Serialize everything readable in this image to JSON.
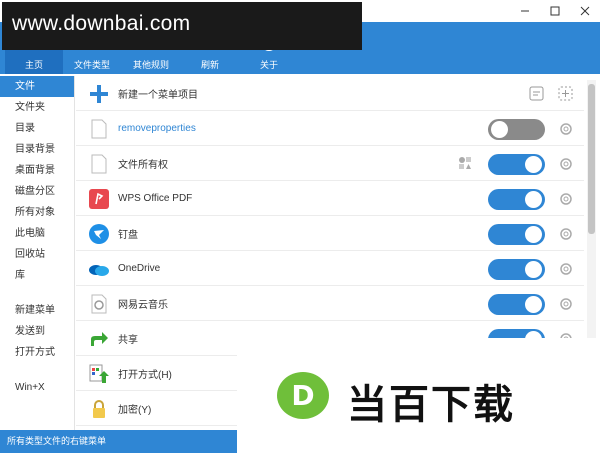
{
  "watermark": {
    "text": "www.downbai.com"
  },
  "toolbar": {
    "items": [
      {
        "label": "主页"
      },
      {
        "label": "文件类型"
      },
      {
        "label": "其他规则"
      },
      {
        "label": "刷新"
      },
      {
        "label": "关于"
      }
    ]
  },
  "sidebar": {
    "items": [
      {
        "label": "文件"
      },
      {
        "label": "文件夹"
      },
      {
        "label": "目录"
      },
      {
        "label": "目录背景"
      },
      {
        "label": "桌面背景"
      },
      {
        "label": "磁盘分区"
      },
      {
        "label": "所有对象"
      },
      {
        "label": "此电脑"
      },
      {
        "label": "回收站"
      },
      {
        "label": "库"
      },
      {
        "label": "新建菜单"
      },
      {
        "label": "发送到"
      },
      {
        "label": "打开方式"
      },
      {
        "label": "Win+X"
      }
    ]
  },
  "list": {
    "new_item_label": "新建一个菜单项目",
    "rows": [
      {
        "label": "removeproperties",
        "enabled": false,
        "icon": "document-icon"
      },
      {
        "label": "文件所有权",
        "enabled": true,
        "icon": "document-icon"
      },
      {
        "label": "WPS Office PDF",
        "enabled": true,
        "icon": "wps-pdf-icon"
      },
      {
        "label": "钉盘",
        "enabled": true,
        "icon": "dingtalk-icon"
      },
      {
        "label": "OneDrive",
        "enabled": true,
        "icon": "onedrive-cloud-icon"
      },
      {
        "label": "网易云音乐",
        "enabled": true,
        "icon": "netease-music-icon"
      },
      {
        "label": "共享",
        "enabled": true,
        "icon": "share-arrow-icon"
      },
      {
        "label": "打开方式(H)",
        "enabled": true,
        "icon": "open-with-icon"
      },
      {
        "label": "加密(Y)",
        "enabled": true,
        "icon": "lock-icon"
      }
    ]
  },
  "status": {
    "text": "所有类型文件的右键菜单"
  },
  "logo": {
    "text": "当百下载",
    "letter": "D"
  },
  "colors": {
    "accent": "#2f86d4",
    "toggle_off": "#8a8a8a",
    "logo_green": "#6fbf3a"
  }
}
